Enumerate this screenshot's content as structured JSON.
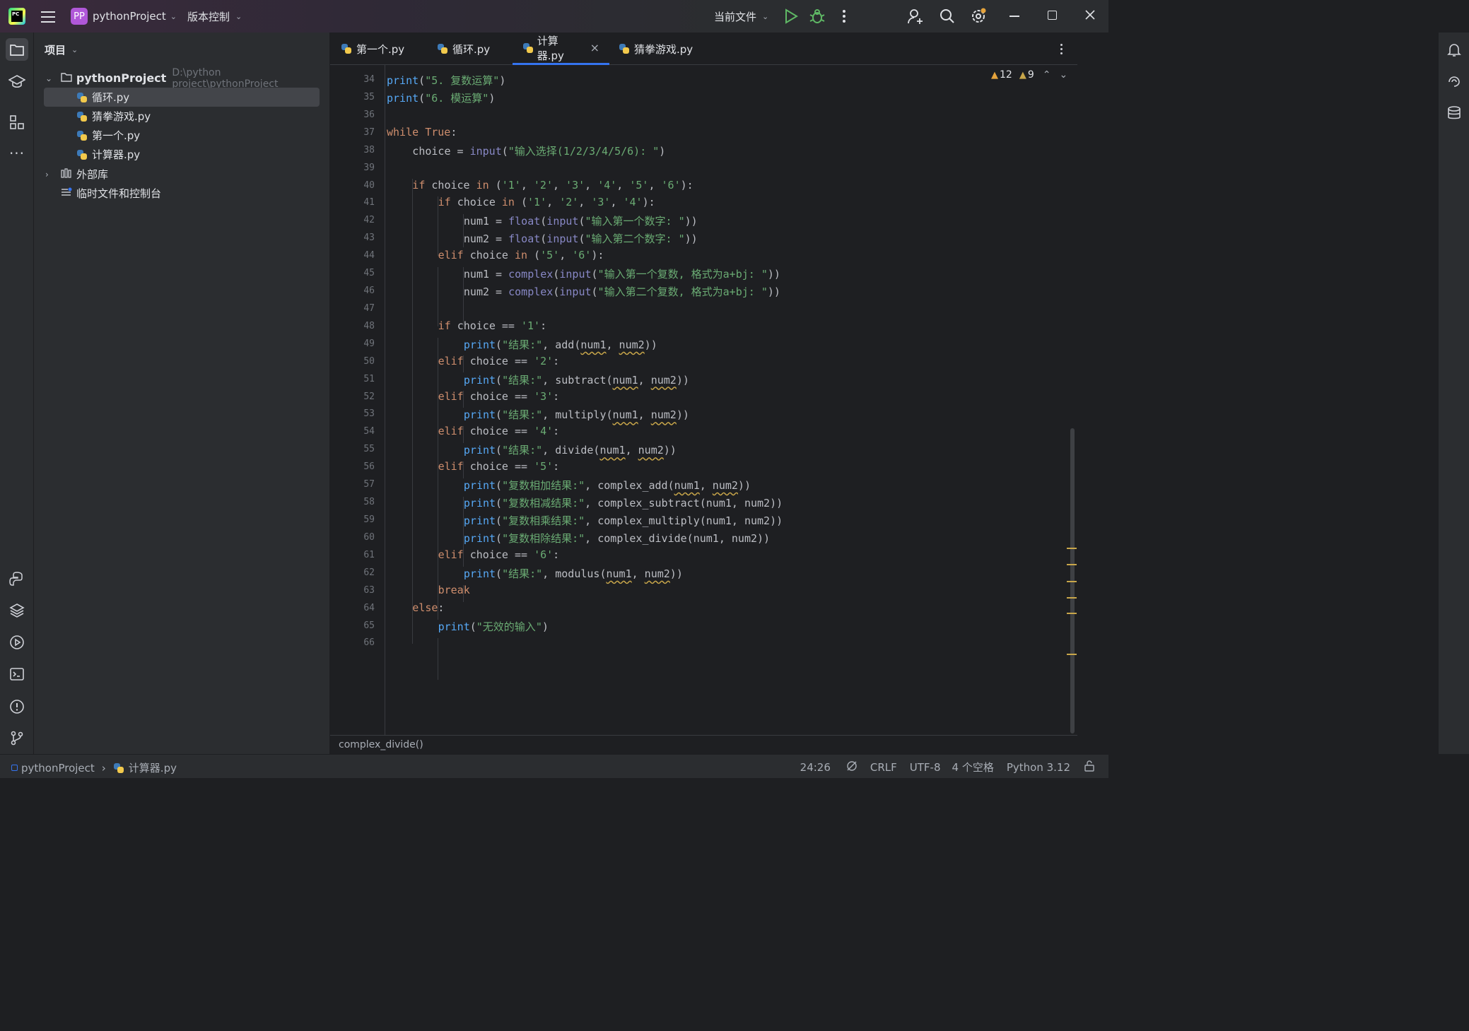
{
  "titlebar": {
    "app_icon": "pycharm-logo-icon",
    "project_badge": "PP",
    "project_name": "pythonProject",
    "vcs_menu": "版本控制",
    "run_config": "当前文件",
    "accent_color": "#b057d8"
  },
  "left_ribbon": [
    "folder-icon",
    "learn-icon",
    "structure-icon",
    "more-icon",
    "python-console-icon",
    "layers-icon",
    "services-icon",
    "terminal-icon",
    "problems-icon",
    "git-icon"
  ],
  "right_ribbon": [
    "notifications-icon",
    "ai-assistant-icon",
    "database-icon"
  ],
  "project_panel": {
    "title": "项目",
    "root_name": "pythonProject",
    "root_path": "D:\\python project\\pythonProject",
    "files": [
      "循环.py",
      "猜拳游戏.py",
      "第一个.py",
      "计算器.py"
    ],
    "selected_file": "循环.py",
    "external_libs": "外部库",
    "scratches": "临时文件和控制台"
  },
  "tabs": [
    {
      "label": "第一个.py",
      "active": false
    },
    {
      "label": "循环.py",
      "active": false
    },
    {
      "label": "计算器.py",
      "active": true
    },
    {
      "label": "猜拳游戏.py",
      "active": false
    }
  ],
  "inspections": {
    "warnings": "12",
    "weak_warnings": "9"
  },
  "code_lines": [
    {
      "n": "34",
      "indent": 0,
      "tokens": [
        [
          "fn",
          "print"
        ],
        [
          "p",
          "("
        ],
        [
          "str",
          "\"5. 复数运算\""
        ],
        [
          "p",
          ")"
        ]
      ]
    },
    {
      "n": "35",
      "indent": 0,
      "tokens": [
        [
          "fn",
          "print"
        ],
        [
          "p",
          "("
        ],
        [
          "str",
          "\"6. 模运算\""
        ],
        [
          "p",
          ")"
        ]
      ]
    },
    {
      "n": "36",
      "indent": 0,
      "tokens": []
    },
    {
      "n": "37",
      "indent": 0,
      "tokens": [
        [
          "kw",
          "while "
        ],
        [
          "kw",
          "True"
        ],
        [
          "p",
          ":"
        ]
      ]
    },
    {
      "n": "38",
      "indent": 1,
      "tokens": [
        [
          "p",
          "choice = "
        ],
        [
          "bi",
          "input"
        ],
        [
          "p",
          "("
        ],
        [
          "str",
          "\"输入选择(1/2/3/4/5/6): \""
        ],
        [
          "p",
          ")"
        ]
      ]
    },
    {
      "n": "39",
      "indent": 0,
      "tokens": []
    },
    {
      "n": "40",
      "indent": 1,
      "tokens": [
        [
          "kw",
          "if "
        ],
        [
          "p",
          "choice "
        ],
        [
          "kw",
          "in "
        ],
        [
          "p",
          "("
        ],
        [
          "str",
          "'1'"
        ],
        [
          "p",
          ", "
        ],
        [
          "str",
          "'2'"
        ],
        [
          "p",
          ", "
        ],
        [
          "str",
          "'3'"
        ],
        [
          "p",
          ", "
        ],
        [
          "str",
          "'4'"
        ],
        [
          "p",
          ", "
        ],
        [
          "str",
          "'5'"
        ],
        [
          "p",
          ", "
        ],
        [
          "str",
          "'6'"
        ],
        [
          "p",
          "):"
        ]
      ]
    },
    {
      "n": "41",
      "indent": 2,
      "tokens": [
        [
          "kw",
          "if "
        ],
        [
          "p",
          "choice "
        ],
        [
          "kw",
          "in "
        ],
        [
          "p",
          "("
        ],
        [
          "str",
          "'1'"
        ],
        [
          "p",
          ", "
        ],
        [
          "str",
          "'2'"
        ],
        [
          "p",
          ", "
        ],
        [
          "str",
          "'3'"
        ],
        [
          "p",
          ", "
        ],
        [
          "str",
          "'4'"
        ],
        [
          "p",
          "):"
        ]
      ]
    },
    {
      "n": "42",
      "indent": 3,
      "tokens": [
        [
          "p",
          "num1 = "
        ],
        [
          "bi",
          "float"
        ],
        [
          "p",
          "("
        ],
        [
          "bi",
          "input"
        ],
        [
          "p",
          "("
        ],
        [
          "str",
          "\"输入第一个数字: \""
        ],
        [
          "p",
          "))"
        ]
      ]
    },
    {
      "n": "43",
      "indent": 3,
      "tokens": [
        [
          "p",
          "num2 = "
        ],
        [
          "bi",
          "float"
        ],
        [
          "p",
          "("
        ],
        [
          "bi",
          "input"
        ],
        [
          "p",
          "("
        ],
        [
          "str",
          "\"输入第二个数字: \""
        ],
        [
          "p",
          "))"
        ]
      ]
    },
    {
      "n": "44",
      "indent": 2,
      "tokens": [
        [
          "kw",
          "elif "
        ],
        [
          "p",
          "choice "
        ],
        [
          "kw",
          "in "
        ],
        [
          "p",
          "("
        ],
        [
          "str",
          "'5'"
        ],
        [
          "p",
          ", "
        ],
        [
          "str",
          "'6'"
        ],
        [
          "p",
          "):"
        ]
      ]
    },
    {
      "n": "45",
      "indent": 3,
      "tokens": [
        [
          "p",
          "num1 = "
        ],
        [
          "bi",
          "complex"
        ],
        [
          "p",
          "("
        ],
        [
          "bi",
          "input"
        ],
        [
          "p",
          "("
        ],
        [
          "str",
          "\"输入第一个复数, 格式为a+bj: \""
        ],
        [
          "p",
          "))"
        ]
      ]
    },
    {
      "n": "46",
      "indent": 3,
      "tokens": [
        [
          "p",
          "num2 = "
        ],
        [
          "bi",
          "complex"
        ],
        [
          "p",
          "("
        ],
        [
          "bi",
          "input"
        ],
        [
          "p",
          "("
        ],
        [
          "str",
          "\"输入第二个复数, 格式为a+bj: \""
        ],
        [
          "p",
          "))"
        ]
      ]
    },
    {
      "n": "47",
      "indent": 0,
      "tokens": []
    },
    {
      "n": "48",
      "indent": 2,
      "tokens": [
        [
          "kw",
          "if "
        ],
        [
          "p",
          "choice == "
        ],
        [
          "str",
          "'1'"
        ],
        [
          "p",
          ":"
        ]
      ]
    },
    {
      "n": "49",
      "indent": 3,
      "tokens": [
        [
          "fn",
          "print"
        ],
        [
          "p",
          "("
        ],
        [
          "str",
          "\"结果:\""
        ],
        [
          "p",
          ", add("
        ],
        [
          "u",
          "num1"
        ],
        [
          "p",
          ", "
        ],
        [
          "u",
          "num2"
        ],
        [
          "p",
          "))"
        ]
      ]
    },
    {
      "n": "50",
      "indent": 2,
      "tokens": [
        [
          "kw",
          "elif "
        ],
        [
          "p",
          "choice == "
        ],
        [
          "str",
          "'2'"
        ],
        [
          "p",
          ":"
        ]
      ]
    },
    {
      "n": "51",
      "indent": 3,
      "tokens": [
        [
          "fn",
          "print"
        ],
        [
          "p",
          "("
        ],
        [
          "str",
          "\"结果:\""
        ],
        [
          "p",
          ", subtract("
        ],
        [
          "u",
          "num1"
        ],
        [
          "p",
          ", "
        ],
        [
          "u",
          "num2"
        ],
        [
          "p",
          "))"
        ]
      ]
    },
    {
      "n": "52",
      "indent": 2,
      "tokens": [
        [
          "kw",
          "elif "
        ],
        [
          "p",
          "choice == "
        ],
        [
          "str",
          "'3'"
        ],
        [
          "p",
          ":"
        ]
      ]
    },
    {
      "n": "53",
      "indent": 3,
      "tokens": [
        [
          "fn",
          "print"
        ],
        [
          "p",
          "("
        ],
        [
          "str",
          "\"结果:\""
        ],
        [
          "p",
          ", multiply("
        ],
        [
          "u",
          "num1"
        ],
        [
          "p",
          ", "
        ],
        [
          "u",
          "num2"
        ],
        [
          "p",
          "))"
        ]
      ]
    },
    {
      "n": "54",
      "indent": 2,
      "tokens": [
        [
          "kw",
          "elif "
        ],
        [
          "p",
          "choice == "
        ],
        [
          "str",
          "'4'"
        ],
        [
          "p",
          ":"
        ]
      ]
    },
    {
      "n": "55",
      "indent": 3,
      "tokens": [
        [
          "fn",
          "print"
        ],
        [
          "p",
          "("
        ],
        [
          "str",
          "\"结果:\""
        ],
        [
          "p",
          ", divide("
        ],
        [
          "u",
          "num1"
        ],
        [
          "p",
          ", "
        ],
        [
          "u",
          "num2"
        ],
        [
          "p",
          "))"
        ]
      ]
    },
    {
      "n": "56",
      "indent": 2,
      "tokens": [
        [
          "kw",
          "elif "
        ],
        [
          "p",
          "choice == "
        ],
        [
          "str",
          "'5'"
        ],
        [
          "p",
          ":"
        ]
      ]
    },
    {
      "n": "57",
      "indent": 3,
      "tokens": [
        [
          "fn",
          "print"
        ],
        [
          "p",
          "("
        ],
        [
          "str",
          "\"复数相加结果:\""
        ],
        [
          "p",
          ", complex_add("
        ],
        [
          "u",
          "num1"
        ],
        [
          "p",
          ", "
        ],
        [
          "u",
          "num2"
        ],
        [
          "p",
          "))"
        ]
      ]
    },
    {
      "n": "58",
      "indent": 3,
      "tokens": [
        [
          "fn",
          "print"
        ],
        [
          "p",
          "("
        ],
        [
          "str",
          "\"复数相减结果:\""
        ],
        [
          "p",
          ", complex_subtract(num1, num2))"
        ]
      ]
    },
    {
      "n": "59",
      "indent": 3,
      "tokens": [
        [
          "fn",
          "print"
        ],
        [
          "p",
          "("
        ],
        [
          "str",
          "\"复数相乘结果:\""
        ],
        [
          "p",
          ", complex_multiply(num1, num2))"
        ]
      ]
    },
    {
      "n": "60",
      "indent": 3,
      "tokens": [
        [
          "fn",
          "print"
        ],
        [
          "p",
          "("
        ],
        [
          "str",
          "\"复数相除结果:\""
        ],
        [
          "p",
          ", complex_divide(num1, num2))"
        ]
      ]
    },
    {
      "n": "61",
      "indent": 2,
      "tokens": [
        [
          "kw",
          "elif "
        ],
        [
          "p",
          "choice == "
        ],
        [
          "str",
          "'6'"
        ],
        [
          "p",
          ":"
        ]
      ]
    },
    {
      "n": "62",
      "indent": 3,
      "tokens": [
        [
          "fn",
          "print"
        ],
        [
          "p",
          "("
        ],
        [
          "str",
          "\"结果:\""
        ],
        [
          "p",
          ", modulus("
        ],
        [
          "u",
          "num1"
        ],
        [
          "p",
          ", "
        ],
        [
          "u",
          "num2"
        ],
        [
          "p",
          "))"
        ]
      ]
    },
    {
      "n": "63",
      "indent": 2,
      "tokens": [
        [
          "kw",
          "break"
        ]
      ]
    },
    {
      "n": "64",
      "indent": 1,
      "tokens": [
        [
          "kw",
          "else"
        ],
        [
          "p",
          ":"
        ]
      ]
    },
    {
      "n": "65",
      "indent": 2,
      "tokens": [
        [
          "fn",
          "print"
        ],
        [
          "p",
          "("
        ],
        [
          "str",
          "\"无效的输入\""
        ],
        [
          "p",
          ")"
        ]
      ]
    },
    {
      "n": "66",
      "indent": 0,
      "tokens": []
    }
  ],
  "breadcrumb_bottom": "complex_divide()",
  "statusbar": {
    "project": "pythonProject",
    "file": "计算器.py",
    "position": "24:26",
    "line_ending": "CRLF",
    "encoding": "UTF-8",
    "indent": "4 个空格",
    "interpreter": "Python 3.12"
  },
  "colors": {
    "keyword": "#cf8e6d",
    "string": "#6aab73",
    "builtin": "#8888c6",
    "function": "#56a8f5",
    "text": "#bcbec4",
    "active_tab": "#3574f0",
    "warning": "#c8a64a"
  }
}
